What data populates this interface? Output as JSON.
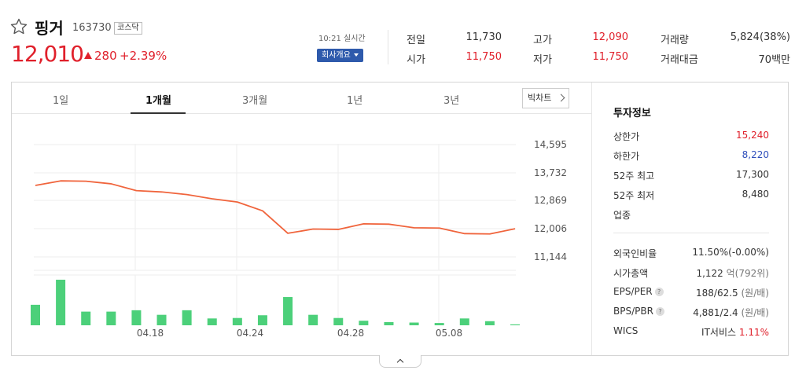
{
  "stock": {
    "name": "핑거",
    "code": "163730",
    "market": "코스닥",
    "price": "12,010",
    "change": "280",
    "change_pct": "+2.39%"
  },
  "header": {
    "realtime": "10:21 실시간",
    "company_button": "회사개요"
  },
  "stats": {
    "prev_close_label": "전일",
    "prev_close": "11,730",
    "open_label": "시가",
    "open": "11,750",
    "high_label": "고가",
    "high": "12,090",
    "low_label": "저가",
    "low": "11,750",
    "volume_label": "거래량",
    "volume": "5,824(38%)",
    "amount_label": "거래대금",
    "amount": "70백만"
  },
  "tabs": [
    "1일",
    "1개월",
    "3개월",
    "1년",
    "3년"
  ],
  "active_tab": "1개월",
  "big_chart_label": "빅차트",
  "invest": {
    "title": "투자정보",
    "upper_limit_label": "상한가",
    "upper_limit": "15,240",
    "lower_limit_label": "하한가",
    "lower_limit": "8,220",
    "high52_label": "52주 최고",
    "high52": "17,300",
    "low52_label": "52주 최저",
    "low52": "8,480",
    "industry_label": "업종",
    "foreign_label": "외국인비율",
    "foreign": "11.50%(-0.00%)",
    "mcap_label": "시가총액",
    "mcap": "1,122",
    "mcap_unit": "억(792위)",
    "eps_label": "EPS/PER",
    "eps": "188/62.5",
    "eps_unit": "(원/배)",
    "bps_label": "BPS/PBR",
    "bps": "4,881/2.4",
    "bps_unit": "(원/배)",
    "wics_label": "WICS",
    "wics": "IT서비스",
    "wics_pct": "1.11%"
  },
  "colors": {
    "up": "#e0202b",
    "down": "#2f4fbb",
    "line": "#f0643c",
    "volume": "#4cd07a"
  },
  "chart_data": {
    "type": "line",
    "y_ticks": [
      "14,595",
      "13,732",
      "12,869",
      "12,006",
      "11,144"
    ],
    "ylim": [
      10800,
      14800
    ],
    "x_labels": [
      "04.18",
      "04.24",
      "04.28",
      "05.08"
    ],
    "price": [
      13340,
      13480,
      13470,
      13390,
      13180,
      13140,
      13060,
      12930,
      12830,
      12560,
      11870,
      12000,
      11990,
      12160,
      12150,
      12040,
      12030,
      11860,
      11850,
      12010
    ],
    "volume": [
      45,
      100,
      30,
      30,
      33,
      23,
      33,
      15,
      16,
      22,
      62,
      23,
      16,
      10,
      7,
      6,
      5,
      15,
      9,
      2
    ]
  }
}
